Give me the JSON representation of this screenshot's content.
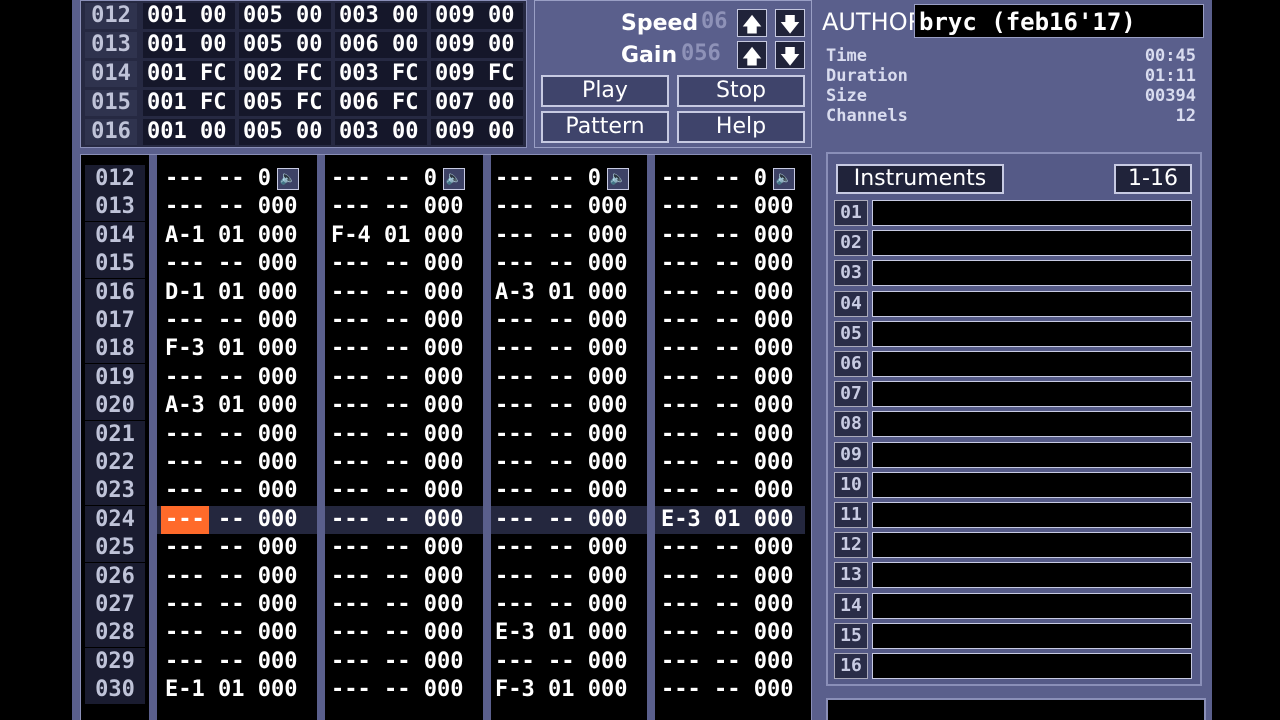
{
  "order_table": {
    "rows": [
      {
        "num": "012",
        "cells": [
          "001 00",
          "005 00",
          "003 00",
          "009 00"
        ]
      },
      {
        "num": "013",
        "cells": [
          "001 00",
          "005 00",
          "006 00",
          "009 00"
        ]
      },
      {
        "num": "014",
        "cells": [
          "001 FC",
          "002 FC",
          "003 FC",
          "009 FC"
        ]
      },
      {
        "num": "015",
        "cells": [
          "001 FC",
          "005 FC",
          "006 FC",
          "007 00"
        ]
      },
      {
        "num": "016",
        "cells": [
          "001 00",
          "005 00",
          "003 00",
          "009 00"
        ]
      }
    ]
  },
  "controls": {
    "speed_label": "Speed",
    "speed_value": "06",
    "gain_label": "Gain",
    "gain_value": "056",
    "play_label": "Play",
    "stop_label": "Stop",
    "pattern_label": "Pattern",
    "help_label": "Help",
    "up_glyph": "🡅",
    "down_glyph": "🡇"
  },
  "song_info": {
    "author_label": "AUTHOR",
    "author_value": "bryc (feb16'17)",
    "time_label": "Time",
    "time_value": "00:45",
    "duration_label": "Duration",
    "duration_value": "01:11",
    "size_label": "Size",
    "size_value": "00394",
    "channels_label": "Channels",
    "channels_value": "12"
  },
  "pattern": {
    "mute_glyph": "🔈",
    "rows": [
      {
        "num": "012",
        "c": [
          "--- -- 0",
          "--- -- 0",
          "--- -- 0",
          "--- -- 0"
        ]
      },
      {
        "num": "013",
        "c": [
          "--- -- 000",
          "--- -- 000",
          "--- -- 000",
          "--- -- 000"
        ]
      },
      {
        "num": "014",
        "c": [
          "A-1 01 000",
          "F-4 01 000",
          "--- -- 000",
          "--- -- 000"
        ]
      },
      {
        "num": "015",
        "c": [
          "--- -- 000",
          "--- -- 000",
          "--- -- 000",
          "--- -- 000"
        ]
      },
      {
        "num": "016",
        "c": [
          "D-1 01 000",
          "--- -- 000",
          "A-3 01 000",
          "--- -- 000"
        ]
      },
      {
        "num": "017",
        "c": [
          "--- -- 000",
          "--- -- 000",
          "--- -- 000",
          "--- -- 000"
        ]
      },
      {
        "num": "018",
        "c": [
          "F-3 01 000",
          "--- -- 000",
          "--- -- 000",
          "--- -- 000"
        ]
      },
      {
        "num": "019",
        "c": [
          "--- -- 000",
          "--- -- 000",
          "--- -- 000",
          "--- -- 000"
        ]
      },
      {
        "num": "020",
        "c": [
          "A-3 01 000",
          "--- -- 000",
          "--- -- 000",
          "--- -- 000"
        ]
      },
      {
        "num": "021",
        "c": [
          "--- -- 000",
          "--- -- 000",
          "--- -- 000",
          "--- -- 000"
        ]
      },
      {
        "num": "022",
        "c": [
          "--- -- 000",
          "--- -- 000",
          "--- -- 000",
          "--- -- 000"
        ]
      },
      {
        "num": "023",
        "c": [
          "--- -- 000",
          "--- -- 000",
          "--- -- 000",
          "--- -- 000"
        ]
      },
      {
        "num": "024",
        "c": [
          "--- -- 000",
          "--- -- 000",
          "--- -- 000",
          "E-3 01 000"
        ]
      },
      {
        "num": "025",
        "c": [
          "--- -- 000",
          "--- -- 000",
          "--- -- 000",
          "--- -- 000"
        ]
      },
      {
        "num": "026",
        "c": [
          "--- -- 000",
          "--- -- 000",
          "--- -- 000",
          "--- -- 000"
        ]
      },
      {
        "num": "027",
        "c": [
          "--- -- 000",
          "--- -- 000",
          "--- -- 000",
          "--- -- 000"
        ]
      },
      {
        "num": "028",
        "c": [
          "--- -- 000",
          "--- -- 000",
          "E-3 01 000",
          "--- -- 000"
        ]
      },
      {
        "num": "029",
        "c": [
          "--- -- 000",
          "--- -- 000",
          "--- -- 000",
          "--- -- 000"
        ]
      },
      {
        "num": "030",
        "c": [
          "E-1 01 000",
          "--- -- 000",
          "F-3 01 000",
          "--- -- 000"
        ]
      }
    ]
  },
  "instruments": {
    "title": "Instruments",
    "range": "1-16",
    "items": [
      "01",
      "02",
      "03",
      "04",
      "05",
      "06",
      "07",
      "08",
      "09",
      "10",
      "11",
      "12",
      "13",
      "14",
      "15",
      "16"
    ]
  }
}
